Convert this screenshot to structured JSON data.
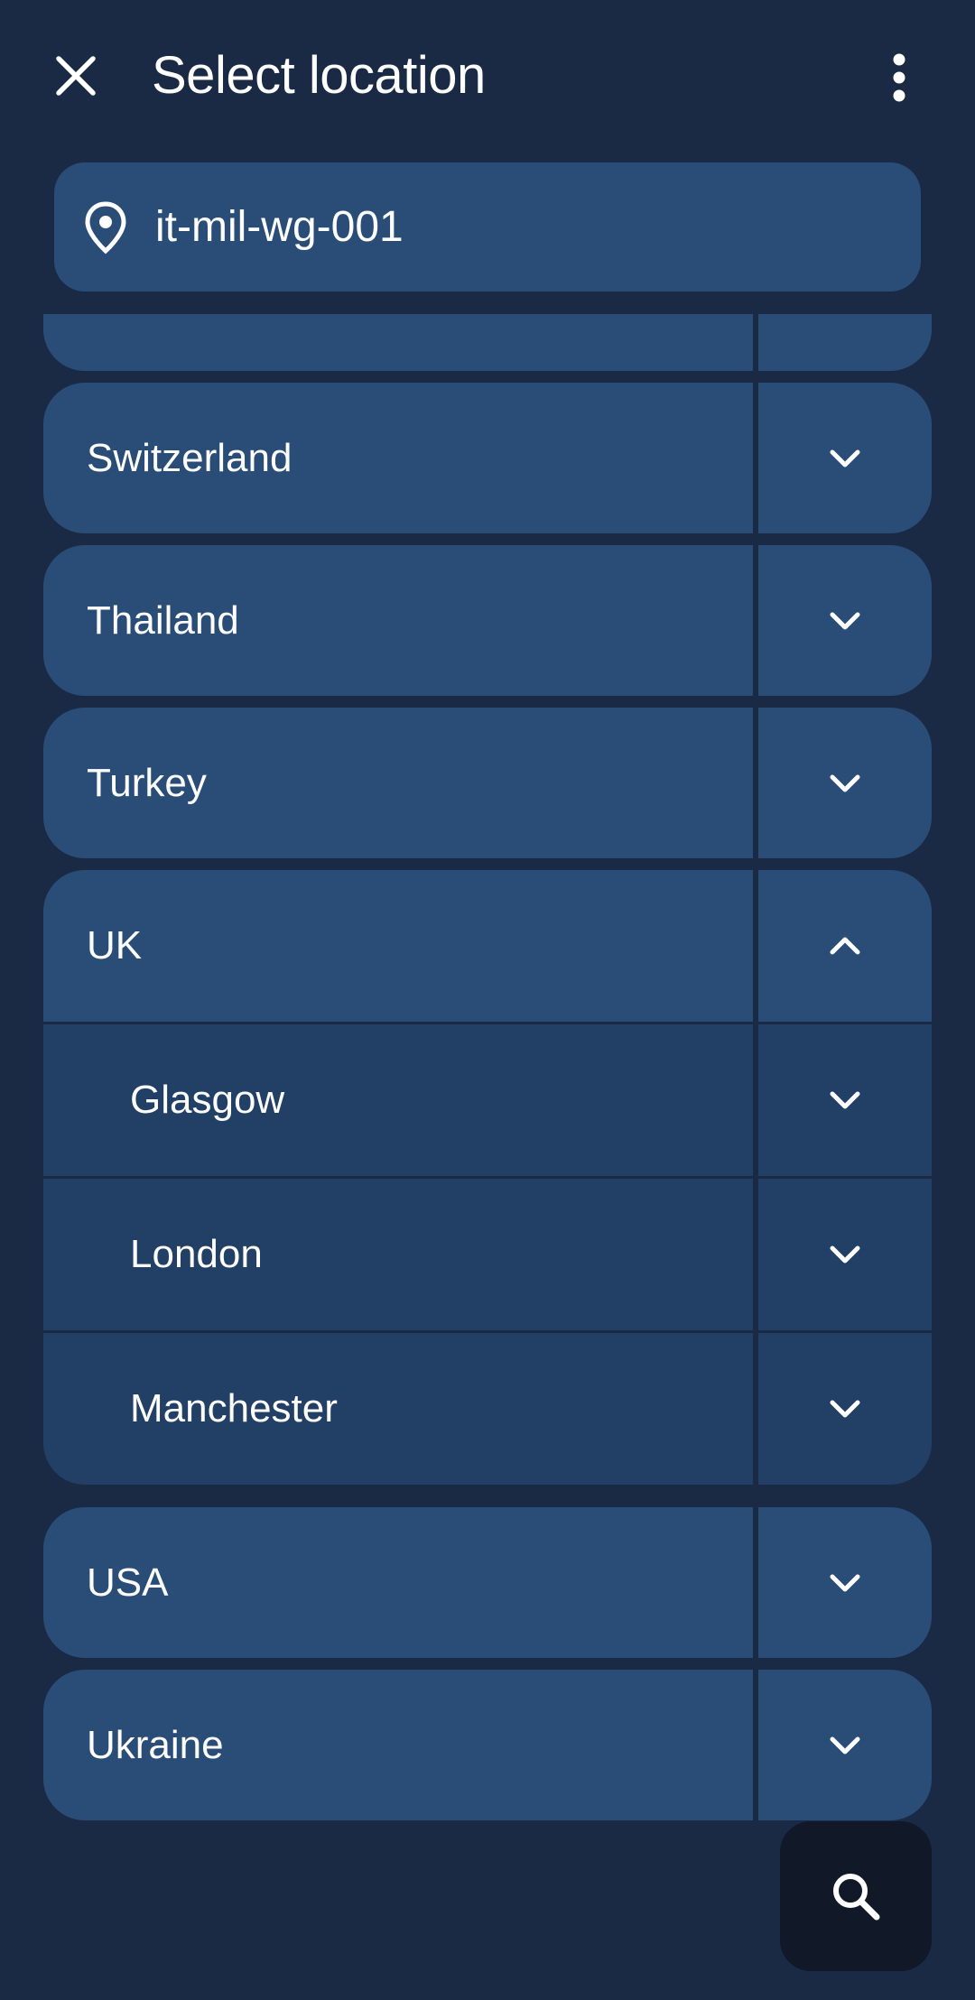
{
  "header": {
    "title": "Select location",
    "close_icon": "close-icon",
    "more_icon": "more-vertical-icon"
  },
  "current_location": {
    "icon": "location-pin-icon",
    "label": "it-mil-wg-001"
  },
  "locations": [
    {
      "label": "",
      "expanded": false,
      "partial": true
    },
    {
      "label": "Switzerland",
      "expanded": false
    },
    {
      "label": "Thailand",
      "expanded": false
    },
    {
      "label": "Turkey",
      "expanded": false
    },
    {
      "label": "UK",
      "expanded": true,
      "children": [
        {
          "label": "Glasgow"
        },
        {
          "label": "London"
        },
        {
          "label": "Manchester"
        }
      ]
    },
    {
      "label": "USA",
      "expanded": false
    },
    {
      "label": "Ukraine",
      "expanded": false
    }
  ],
  "fab": {
    "icon": "search-icon"
  },
  "colors": {
    "background": "#1a2a45",
    "row": "#2a4d78",
    "child_row": "#223f65",
    "fab": "#111827",
    "text": "#ffffff"
  }
}
